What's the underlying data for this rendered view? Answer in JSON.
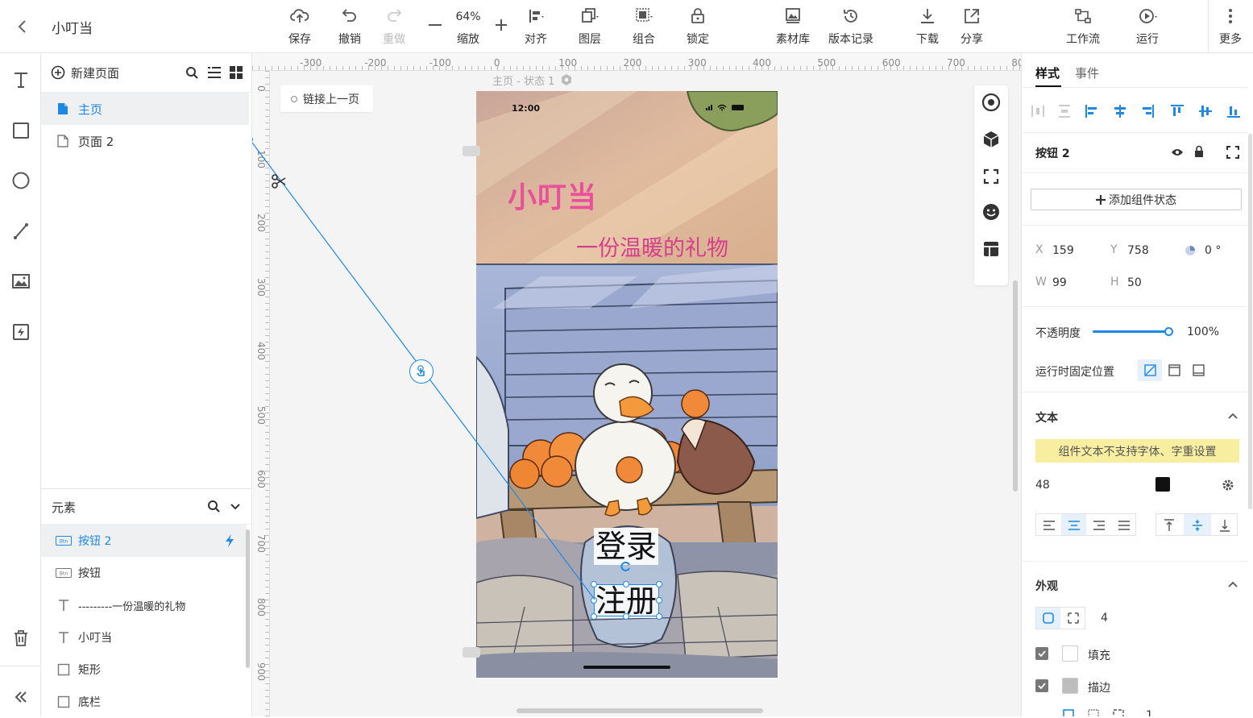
{
  "app": {
    "title": "小叮当"
  },
  "toolbar": {
    "save": "保存",
    "undo": "撤销",
    "redo": "重做",
    "zoom_value": "64%",
    "zoom": "缩放",
    "align": "对齐",
    "layer": "图层",
    "group": "组合",
    "lock": "锁定",
    "assets": "素材库",
    "versions": "版本记录",
    "download": "下载",
    "share": "分享",
    "workflow": "工作流",
    "run": "运行",
    "more": "更多"
  },
  "pages_panel": {
    "new_page": "新建页面",
    "pages": [
      "主页",
      "页面 2"
    ]
  },
  "elements_panel": {
    "title": "元素",
    "items": [
      "按钮 2",
      "按钮",
      "---------一份温暖的礼物",
      "小叮当",
      "矩形",
      "底栏"
    ]
  },
  "canvas": {
    "ruler_x": [
      "-300",
      "-200",
      "-100",
      "0",
      "100",
      "200",
      "300",
      "400",
      "500",
      "600",
      "700",
      "80"
    ],
    "ruler_y": [
      "0",
      "100",
      "200",
      "300",
      "400",
      "500",
      "600",
      "700",
      "800",
      "900"
    ],
    "link_prev_page": "链接上一页",
    "frame_label": "主页 - 状态 1",
    "status_time": "12:00",
    "phone_title": "小叮当",
    "phone_subtitle": "一份温暖的礼物",
    "login_button": "登录",
    "register_button": "注册"
  },
  "right_panel": {
    "tabs": [
      "样式",
      "事件"
    ],
    "component_name": "按钮 2",
    "add_state": "添加组件状态",
    "x_label": "X",
    "x_value": "159",
    "y_label": "Y",
    "y_value": "758",
    "rotation": "0 °",
    "w_label": "W",
    "w_value": "99",
    "h_label": "H",
    "h_value": "50",
    "opacity_label": "不透明度",
    "opacity_value": "100%",
    "opacity_fraction": 1.0,
    "fixed_label": "运行时固定位置",
    "text_section": "文本",
    "text_warning": "组件文本不支持字体、字重设置",
    "font_size": "48",
    "text_color": "#111111",
    "appearance_section": "外观",
    "radius": "4",
    "fill_label": "填充",
    "stroke_label": "描边",
    "stroke_width": "1"
  },
  "colors": {
    "accent": "#1e88e5",
    "title_pink": "#e8509a",
    "subtitle_pink": "#d63f8c",
    "warning_bg": "#f8eea0"
  }
}
